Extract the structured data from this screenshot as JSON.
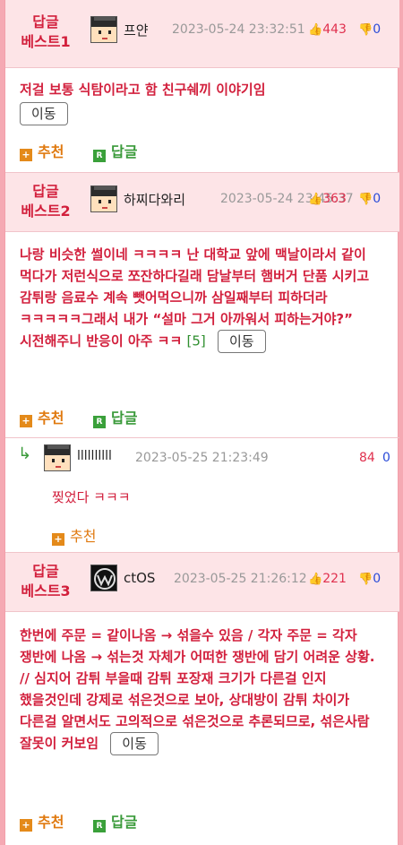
{
  "comments": [
    {
      "best_label": "답글\n베스트1",
      "nick": "프얀",
      "date": "2023-05-24 23:32:51",
      "up": "443",
      "down": "0",
      "body": "저걸 보통 식탐이라고 함 친구쉐끼 이야기임",
      "move_label": "이동",
      "recommend_label": "추천",
      "reply_label": "답글"
    },
    {
      "best_label": "답글\n베스트2",
      "nick": "하찌다와리",
      "date": "2023-05-24 23:45:37",
      "up": "363",
      "down": "0",
      "body": "나랑 비슷한 썰이네 ㅋㅋㅋㅋ 난 대학교 앞에 맥날이라서 같이 먹다가 저런식으로 쪼잔하다길래 담날부터 햄버거 단품 시키고 감튀랑 음료수 계속 뺏어먹으니까 삼일째부터 피하더라 ㅋㅋㅋㅋㅋ그래서 내가 “설마 그거 아까워서 피하는거야?” 시전해주니 반응이 아주 ㅋㅋ",
      "reply_count": "[5]",
      "move_label": "이동",
      "recommend_label": "추천",
      "reply_label": "답글"
    },
    {
      "best_label": "답글\n베스트3",
      "nick": "ctOS",
      "date": "2023-05-25 21:26:12",
      "up": "221",
      "down": "0",
      "body": "한번에 주문 = 같이나옴 → 섞을수 있음 / 각자 주문 = 각자 쟁반에 나옴 → 섞는것 자체가 어떠한 쟁반에 담기 어려운 상황. // 심지어 감튀 부을때 감튀 포장재 크기가 다른걸 인지 했을것인데 강제로 섞은것으로 보아, 상대방이 감튀 차이가 다른걸 알면서도 고의적으로 섞은것으로 추론되므로, 섞은사람 잘못이 커보임",
      "move_label": "이동",
      "recommend_label": "추천",
      "reply_label": "답글"
    }
  ],
  "sub_reply": {
    "arrow": "↳",
    "nick": "llllllllll",
    "date": "2023-05-25 21:23:49",
    "up": "84",
    "down": "0",
    "body": "찢었다 ㅋㅋㅋ",
    "recommend_label": "추천"
  },
  "icons": {
    "thumb_up": "thumb-up-icon",
    "thumb_down": "thumb-down-icon",
    "plus": "plus-icon",
    "reply": "reply-r-icon"
  },
  "colors": {
    "best": "#d21f3c",
    "up": "#e0304e",
    "down": "#2a4bd8",
    "recommend": "#e07a10",
    "reply": "#3a9a3a"
  }
}
